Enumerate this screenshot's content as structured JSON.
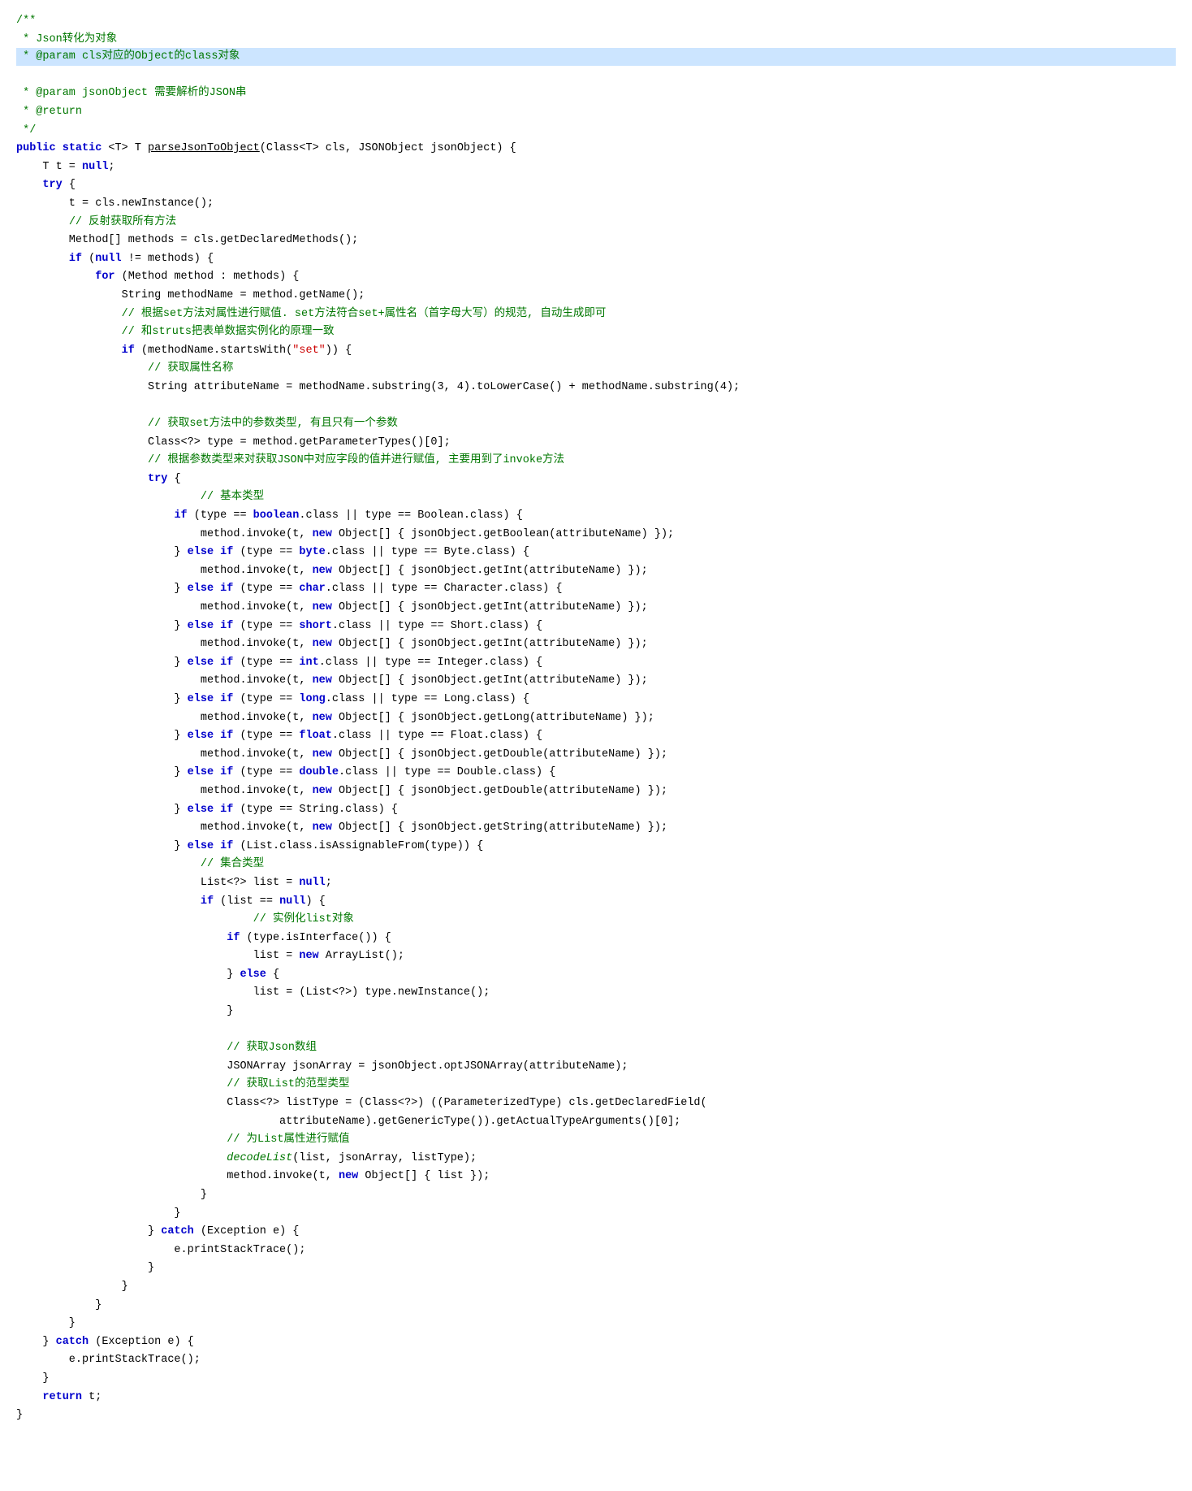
{
  "code": {
    "lines": [
      {
        "text": "/**",
        "type": "comment",
        "highlight": false
      },
      {
        "text": " * Json转化为对象",
        "type": "comment",
        "highlight": false
      },
      {
        "text": " * @param cls对应的Object的class对象",
        "type": "comment-highlight",
        "highlight": true
      },
      {
        "text": " * @param jsonObject 需要解析的JSON串",
        "type": "comment",
        "highlight": false
      },
      {
        "text": " * @return",
        "type": "comment",
        "highlight": false
      },
      {
        "text": " */",
        "type": "comment",
        "highlight": false
      },
      {
        "text": "public static <T> T parseJsonToObject(Class<T> cls, JSONObject jsonObject) {",
        "type": "code",
        "highlight": false
      },
      {
        "text": "    T t = null;",
        "type": "code",
        "highlight": false
      },
      {
        "text": "    try {",
        "type": "code",
        "highlight": false
      },
      {
        "text": "        t = cls.newInstance();",
        "type": "code",
        "highlight": false
      },
      {
        "text": "        // 反射获取所有方法",
        "type": "comment-inline",
        "highlight": false
      },
      {
        "text": "        Method[] methods = cls.getDeclaredMethods();",
        "type": "code",
        "highlight": false
      },
      {
        "text": "        if (null != methods) {",
        "type": "code",
        "highlight": false
      },
      {
        "text": "            for (Method method : methods) {",
        "type": "code",
        "highlight": false
      },
      {
        "text": "                String methodName = method.getName();",
        "type": "code",
        "highlight": false
      },
      {
        "text": "                // 根据set方法对属性进行赋值. set方法符合set+属性名（首字母大写）的规范, 自动生成即可",
        "type": "comment-inline",
        "highlight": false
      },
      {
        "text": "                // 和struts把表单数据实例化的原理一致",
        "type": "comment-inline",
        "highlight": false
      },
      {
        "text": "                if (methodName.startsWith(\"set\")) {",
        "type": "code",
        "highlight": false
      },
      {
        "text": "                    // 获取属性名称",
        "type": "comment-inline",
        "highlight": false
      },
      {
        "text": "                    String attributeName = methodName.substring(3, 4).toLowerCase() + methodName.substring(4);",
        "type": "code",
        "highlight": false
      },
      {
        "text": "",
        "type": "blank",
        "highlight": false
      },
      {
        "text": "                    // 获取set方法中的参数类型, 有且只有一个参数",
        "type": "comment-inline",
        "highlight": false
      },
      {
        "text": "                    Class<?> type = method.getParameterTypes()[0];",
        "type": "code",
        "highlight": false
      },
      {
        "text": "                    // 根据参数类型来对获取JSON中对应字段的值并进行赋值, 主要用到了invoke方法",
        "type": "comment-inline",
        "highlight": false
      },
      {
        "text": "                    try {",
        "type": "code",
        "highlight": false
      },
      {
        "text": "                            // 基本类型",
        "type": "comment-inline",
        "highlight": false
      },
      {
        "text": "                        if (type == boolean.class || type == Boolean.class) {",
        "type": "code",
        "highlight": false
      },
      {
        "text": "                            method.invoke(t, new Object[] { jsonObject.getBoolean(attributeName) });",
        "type": "code",
        "highlight": false
      },
      {
        "text": "                        } else if (type == byte.class || type == Byte.class) {",
        "type": "code",
        "highlight": false
      },
      {
        "text": "                            method.invoke(t, new Object[] { jsonObject.getInt(attributeName) });",
        "type": "code",
        "highlight": false
      },
      {
        "text": "                        } else if (type == char.class || type == Character.class) {",
        "type": "code",
        "highlight": false
      },
      {
        "text": "                            method.invoke(t, new Object[] { jsonObject.getInt(attributeName) });",
        "type": "code",
        "highlight": false
      },
      {
        "text": "                        } else if (type == short.class || type == Short.class) {",
        "type": "code",
        "highlight": false
      },
      {
        "text": "                            method.invoke(t, new Object[] { jsonObject.getInt(attributeName) });",
        "type": "code",
        "highlight": false
      },
      {
        "text": "                        } else if (type == int.class || type == Integer.class) {",
        "type": "code",
        "highlight": false
      },
      {
        "text": "                            method.invoke(t, new Object[] { jsonObject.getInt(attributeName) });",
        "type": "code",
        "highlight": false
      },
      {
        "text": "                        } else if (type == long.class || type == Long.class) {",
        "type": "code",
        "highlight": false
      },
      {
        "text": "                            method.invoke(t, new Object[] { jsonObject.getLong(attributeName) });",
        "type": "code",
        "highlight": false
      },
      {
        "text": "                        } else if (type == float.class || type == Float.class) {",
        "type": "code",
        "highlight": false
      },
      {
        "text": "                            method.invoke(t, new Object[] { jsonObject.getDouble(attributeName) });",
        "type": "code",
        "highlight": false
      },
      {
        "text": "                        } else if (type == double.class || type == Double.class) {",
        "type": "code",
        "highlight": false
      },
      {
        "text": "                            method.invoke(t, new Object[] { jsonObject.getDouble(attributeName) });",
        "type": "code",
        "highlight": false
      },
      {
        "text": "                        } else if (type == String.class) {",
        "type": "code",
        "highlight": false
      },
      {
        "text": "                            method.invoke(t, new Object[] { jsonObject.getString(attributeName) });",
        "type": "code",
        "highlight": false
      },
      {
        "text": "                        } else if (List.class.isAssignableFrom(type)) {",
        "type": "code",
        "highlight": false
      },
      {
        "text": "                            // 集合类型",
        "type": "comment-inline",
        "highlight": false
      },
      {
        "text": "                            List<?> list = null;",
        "type": "code",
        "highlight": false
      },
      {
        "text": "                            if (list == null) {",
        "type": "code",
        "highlight": false
      },
      {
        "text": "                                    // 实例化list对象",
        "type": "comment-inline",
        "highlight": false
      },
      {
        "text": "                                if (type.isInterface()) {",
        "type": "code",
        "highlight": false
      },
      {
        "text": "                                    list = new ArrayList();",
        "type": "code",
        "highlight": false
      },
      {
        "text": "                                } else {",
        "type": "code",
        "highlight": false
      },
      {
        "text": "                                    list = (List<?>) type.newInstance();",
        "type": "code",
        "highlight": false
      },
      {
        "text": "                                }",
        "type": "code",
        "highlight": false
      },
      {
        "text": "",
        "type": "blank",
        "highlight": false
      },
      {
        "text": "                                // 获取Json数组",
        "type": "comment-inline",
        "highlight": false
      },
      {
        "text": "                                JSONArray jsonArray = jsonObject.optJSONArray(attributeName);",
        "type": "code",
        "highlight": false
      },
      {
        "text": "                                // 获取List的范型类型",
        "type": "comment-inline",
        "highlight": false
      },
      {
        "text": "                                Class<?> listType = (Class<?>) ((ParameterizedType) cls.getDeclaredField(",
        "type": "code",
        "highlight": false
      },
      {
        "text": "                                        attributeName).getGenericType()).getActualTypeArguments()[0];",
        "type": "code",
        "highlight": false
      },
      {
        "text": "                                // 为List属性进行赋值",
        "type": "comment-inline",
        "highlight": false
      },
      {
        "text": "                                decodeList(list, jsonArray, listType);",
        "type": "code-italic",
        "highlight": false
      },
      {
        "text": "                                method.invoke(t, new Object[] { list });",
        "type": "code",
        "highlight": false
      },
      {
        "text": "                            }",
        "type": "code",
        "highlight": false
      },
      {
        "text": "                        }",
        "type": "code",
        "highlight": false
      },
      {
        "text": "                    } catch (Exception e) {",
        "type": "code",
        "highlight": false
      },
      {
        "text": "                        e.printStackTrace();",
        "type": "code",
        "highlight": false
      },
      {
        "text": "                    }",
        "type": "code",
        "highlight": false
      },
      {
        "text": "                }",
        "type": "code",
        "highlight": false
      },
      {
        "text": "            }",
        "type": "code",
        "highlight": false
      },
      {
        "text": "        }",
        "type": "code",
        "highlight": false
      },
      {
        "text": "    } catch (Exception e) {",
        "type": "code",
        "highlight": false
      },
      {
        "text": "        e.printStackTrace();",
        "type": "code",
        "highlight": false
      },
      {
        "text": "    }",
        "type": "code",
        "highlight": false
      },
      {
        "text": "    return t;",
        "type": "code",
        "highlight": false
      },
      {
        "text": "}",
        "type": "code",
        "highlight": false
      }
    ]
  }
}
